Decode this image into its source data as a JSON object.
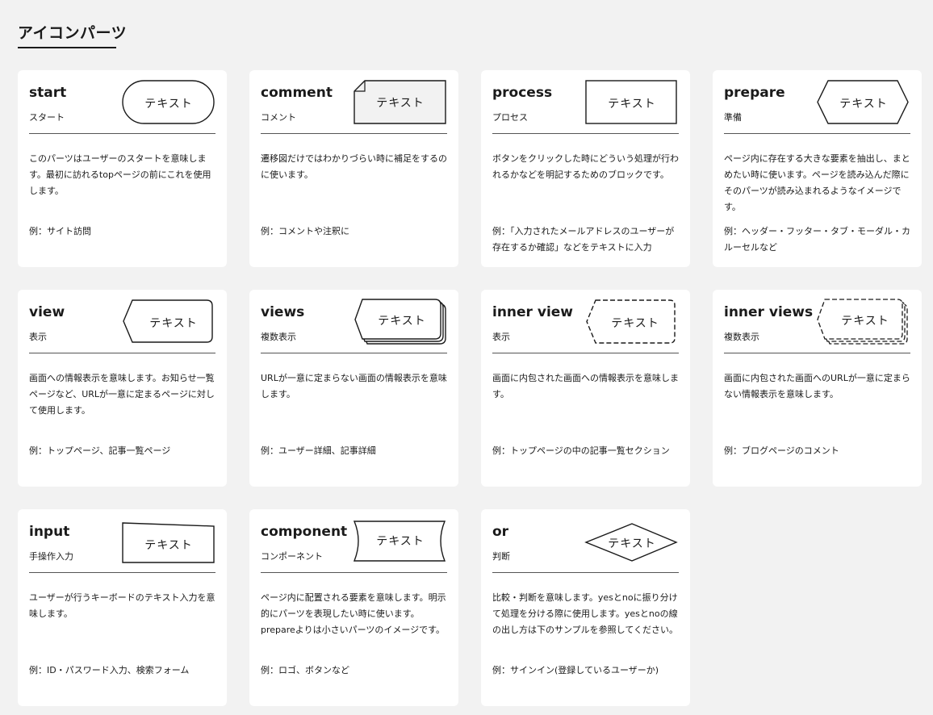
{
  "section_title": "アイコンパーツ",
  "example_prefix": "例：",
  "cards": [
    {
      "name": "start",
      "subtitle": "スタート",
      "shape": "terminal",
      "shape_text": "テキスト",
      "description": "このパーツはユーザーのスタートを意味します。最初に訪れるtopページの前にこれを使用します。",
      "example": "例：サイト訪問"
    },
    {
      "name": "comment",
      "subtitle": "コメント",
      "shape": "note",
      "shape_text": "テキスト",
      "description": "遷移図だけではわかりづらい時に補足をするのに使います。",
      "example": "例：コメントや注釈に"
    },
    {
      "name": "process",
      "subtitle": "プロセス",
      "shape": "rectangle",
      "shape_text": "テキスト",
      "description": "ボタンをクリックした時にどういう処理が行われるかなどを明記するためのブロックです。",
      "example": "例：「入力されたメールアドレスのユーザーが存在するか確認」などをテキストに入力"
    },
    {
      "name": "prepare",
      "subtitle": "準備",
      "shape": "hexagon",
      "shape_text": "テキスト",
      "description": "ページ内に存在する大きな要素を抽出し、まとめたい時に使います。ページを読み込んだ際にそのパーツが読み込まれるようなイメージです。",
      "example": "例：ヘッダー・フッター・タブ・モーダル・カルーセルなど"
    },
    {
      "name": "view",
      "subtitle": "表示",
      "shape": "display",
      "shape_text": "テキスト",
      "description": "画面への情報表示を意味します。お知らせ一覧ページなど、URLが一意に定まるページに対して使用します。",
      "example": "例：トップページ、記事一覧ページ"
    },
    {
      "name": "views",
      "subtitle": "複数表示",
      "shape": "display-multi",
      "shape_text": "テキスト",
      "description": "URLが一意に定まらない画面の情報表示を意味します。",
      "example": "例：ユーザー詳細、記事詳細"
    },
    {
      "name": "inner view",
      "subtitle": "表示",
      "shape": "display-dashed",
      "shape_text": "テキスト",
      "description": "画面に内包された画面への情報表示を意味します。",
      "example": "例：トップページの中の記事一覧セクション"
    },
    {
      "name": "inner views",
      "subtitle": "複数表示",
      "shape": "display-dashed-multi",
      "shape_text": "テキスト",
      "description": "画面に内包された画面へのURLが一意に定まらない情報表示を意味します。",
      "example": "例：ブログページのコメント"
    },
    {
      "name": "input",
      "subtitle": "手操作入力",
      "shape": "manual-input",
      "shape_text": "テキスト",
      "description": "ユーザーが行うキーボードのテキスト入力を意味します。",
      "example": "例：ID・パスワード入力、検索フォーム"
    },
    {
      "name": "component",
      "subtitle": "コンポーネント",
      "shape": "component",
      "shape_text": "テキスト",
      "description": "ページ内に配置される要素を意味します。明示的にパーツを表現したい時に使います。prepareよりは小さいパーツのイメージです。",
      "example": "例：ロゴ、ボタンなど"
    },
    {
      "name": "or",
      "subtitle": "判断",
      "shape": "diamond",
      "shape_text": "テキスト",
      "description": "比較・判断を意味します。yesとnoに振り分けて処理を分ける際に使用します。yesとnoの線の出し方は下のサンプルを参照してください。",
      "example": "例：サインイン(登録しているユーザーか)"
    }
  ]
}
